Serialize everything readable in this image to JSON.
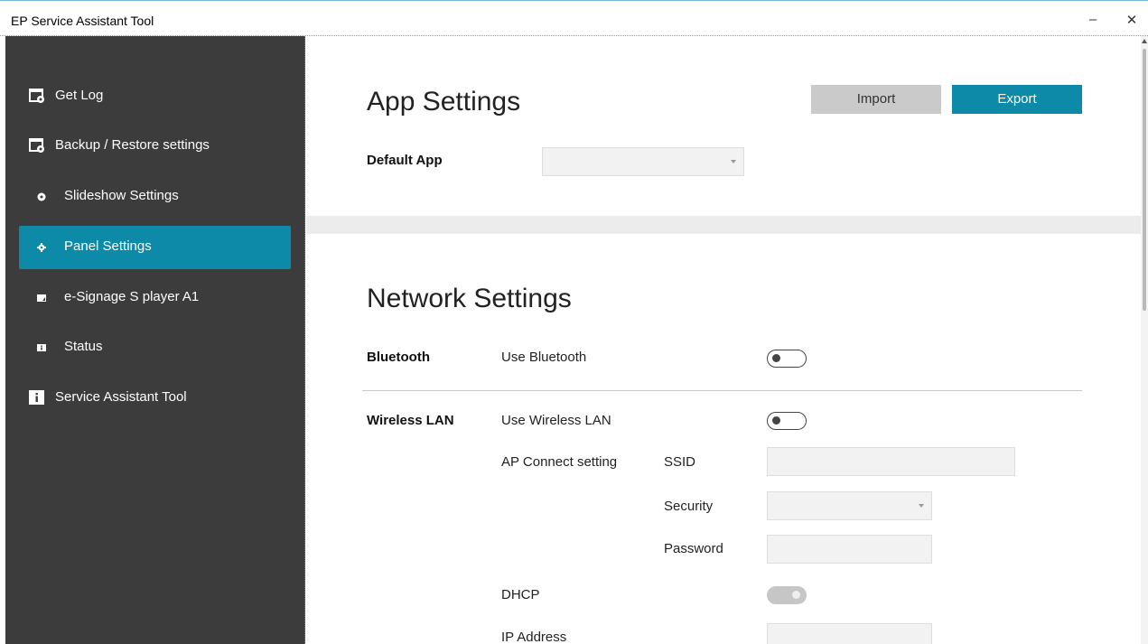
{
  "window": {
    "title": "EP Service Assistant Tool",
    "minimize_glyph": "–",
    "close_glyph": "✕"
  },
  "sidebar": {
    "items": [
      {
        "label": "Get Log",
        "icon": "log-settings-icon",
        "level": "top",
        "active": false
      },
      {
        "label": "Backup / Restore settings",
        "icon": "backup-settings-icon",
        "level": "top",
        "active": false
      },
      {
        "label": "Slideshow Settings",
        "icon": "circle-bullet-icon",
        "level": "sub",
        "active": false
      },
      {
        "label": "Panel Settings",
        "icon": "gear-icon",
        "level": "sub",
        "active": true
      },
      {
        "label": "e-Signage S player A1",
        "icon": "player-icon",
        "level": "sub",
        "active": false
      },
      {
        "label": "Status",
        "icon": "info-icon",
        "level": "sub",
        "active": false
      },
      {
        "label": "Service Assistant Tool",
        "icon": "info-box-icon",
        "level": "top",
        "active": false
      }
    ]
  },
  "app_settings": {
    "title": "App Settings",
    "import_label": "Import",
    "export_label": "Export",
    "default_app_label": "Default App",
    "default_app_value": ""
  },
  "network_settings": {
    "title": "Network Settings",
    "bluetooth": {
      "section_label": "Bluetooth",
      "use_label": "Use Bluetooth",
      "enabled": false
    },
    "wireless_lan": {
      "section_label": "Wireless LAN",
      "use_label": "Use Wireless LAN",
      "enabled": false,
      "ap_connect_label": "AP Connect setting",
      "ssid_label": "SSID",
      "ssid_value": "",
      "security_label": "Security",
      "security_value": "",
      "password_label": "Password",
      "password_value": "",
      "dhcp_label": "DHCP",
      "dhcp_enabled": true,
      "dhcp_disabled_control": true,
      "ip_address_label": "IP Address",
      "ip_address_value": ""
    }
  },
  "colors": {
    "accent": "#0d8aa8",
    "sidebar_bg": "#3c3c3c",
    "import_bg": "#cacaca"
  }
}
